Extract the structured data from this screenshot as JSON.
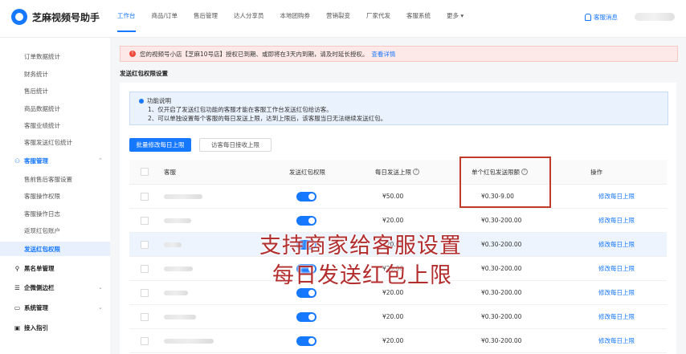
{
  "app": {
    "title": "芝麻视频号助手"
  },
  "nav": {
    "items": [
      "工作台",
      "商品/订单",
      "售后管理",
      "达人分享员",
      "本地团购券",
      "营销裂变",
      "厂家代发",
      "客服系统",
      "更多"
    ],
    "support_label": "客服消息"
  },
  "sidebar": {
    "stats": [
      "订单数据统计",
      "财务统计",
      "售后统计",
      "商品数据统计",
      "客服业绩统计",
      "客服发送红包统计"
    ],
    "group_service": "客服管理",
    "service_items": [
      "售前售后客服设置",
      "客服操作权限",
      "客服操作日志",
      "返现红包账户",
      "发送红包权限"
    ],
    "group_blacklist": "黑名单管理",
    "group_sidebar": "企微侧边栏",
    "group_system": "系统管理",
    "group_guide": "接入指引"
  },
  "alert": {
    "text": "您的视频号小店【芝麻10号店】授权已到期、或即将在3天内到期，请及时延长授权。",
    "link": "查看详情"
  },
  "page": {
    "section_title": "发送红包权限设置"
  },
  "info": {
    "title": "功能说明",
    "line1": "1、仅开启了发送红包功能的客服才能在客服工作台发送红包给访客。",
    "line2": "2、可以单独设置每个客服的每日发送上限，达到上限后，该客服当日无法继续发送红包。"
  },
  "buttons": {
    "batch": "批量修改每日上限",
    "visitor": "访客每日接收上限"
  },
  "table": {
    "headers": {
      "name": "客服",
      "permission": "发送红包权限",
      "daily_limit": "每日发送上限",
      "single_limit": "单个红包发送限额",
      "action": "操作"
    },
    "rows": [
      {
        "daily": "¥50.00",
        "single": "¥0.30-9.00",
        "action": "修改每日上限",
        "enabled": true
      },
      {
        "daily": "¥20.00",
        "single": "¥0.30-200.00",
        "action": "修改每日上限",
        "enabled": true
      },
      {
        "daily": "¥20.00",
        "single": "¥0.30-200.00",
        "action": "修改每日上限",
        "enabled": true
      },
      {
        "daily": "¥20.00",
        "single": "¥0.30-200.00",
        "action": "修改每日上限",
        "enabled": true
      },
      {
        "daily": "¥20.00",
        "single": "¥0.30-200.00",
        "action": "修改每日上限",
        "enabled": true
      },
      {
        "daily": "¥20.00",
        "single": "¥0.30-200.00",
        "action": "修改每日上限",
        "enabled": true
      },
      {
        "daily": "¥20.00",
        "single": "¥0.30-200.00",
        "action": "修改每日上限",
        "enabled": true
      }
    ]
  },
  "overlay": {
    "line1": "支持商家给客服设置",
    "line2": "每日发送红包上限"
  },
  "colors": {
    "accent": "#1677ff",
    "alert_bg": "#fde9e7",
    "highlight_box": "#c0392b",
    "overlay_text": "#b32d2d"
  }
}
